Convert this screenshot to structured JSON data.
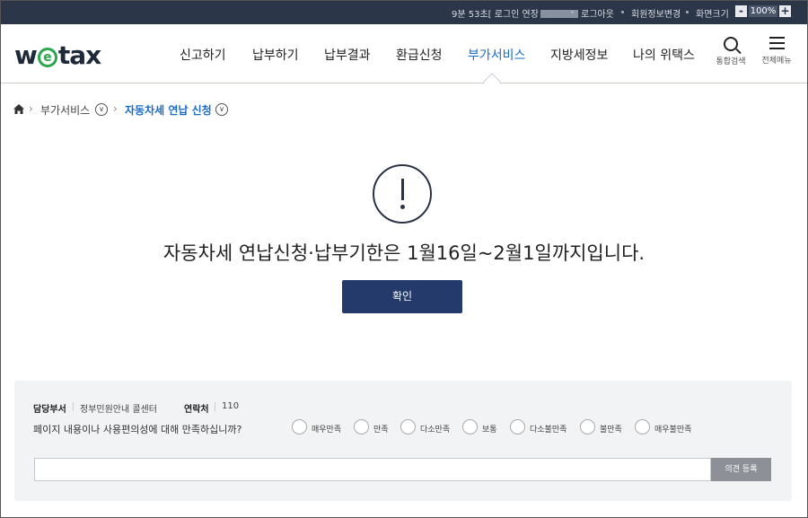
{
  "topbar": {
    "session_text": "9분 53초[ 로그인 연장",
    "logout": "로그아웃",
    "member_edit": "회원정보변경",
    "screen_size": "화면크기",
    "zoom_minus": "-",
    "zoom_value": "100%",
    "zoom_plus": "+"
  },
  "header": {
    "logo_left": "w",
    "logo_e": "e",
    "logo_right": "tax",
    "nav": [
      "신고하기",
      "납부하기",
      "납부결과",
      "환급신청",
      "부가서비스",
      "지방세정보",
      "나의 위택스"
    ],
    "active_nav_index": 4,
    "search_label": "통합검색",
    "menu_label": "전체메뉴"
  },
  "breadcrumb": {
    "level1": "부가서비스",
    "current": "자동차세 연납 신청"
  },
  "alert": {
    "icon": "exclamation-icon",
    "message": "자동차세 연납신청·납부기한은 1월16일~2월1일까지입니다.",
    "confirm": "확인"
  },
  "survey": {
    "dept_label": "담당부서",
    "dept_value": "정부민원안내 콜센터",
    "contact_label": "연락처",
    "contact_value": "110",
    "question": "페이지 내용이나 사용편의성에 대해 만족하십니까?",
    "options": [
      "매우만족",
      "만족",
      "다소만족",
      "보통",
      "다소불만족",
      "불만족",
      "매우불만족"
    ],
    "input_value": "",
    "submit": "의견 등록"
  },
  "colors": {
    "topbar_bg": "#2b3648",
    "accent": "#1a6bc8",
    "button_bg": "#243a6b",
    "logo_e": "#2aa84a"
  }
}
